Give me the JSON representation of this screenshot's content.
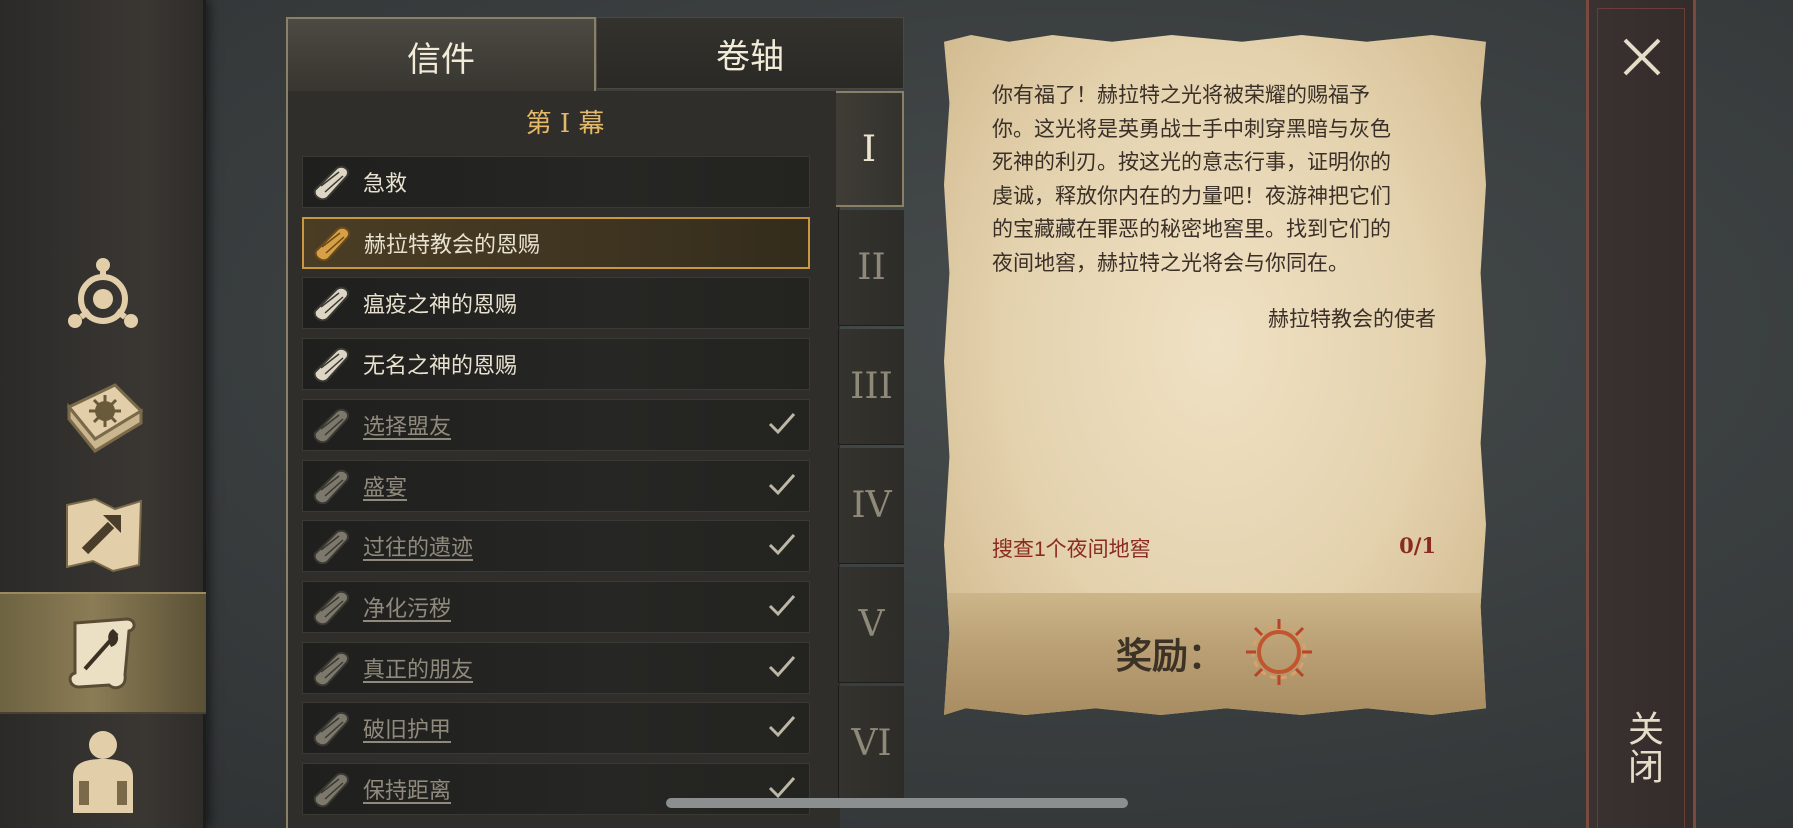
{
  "tabs": {
    "letters": "信件",
    "scrolls": "卷轴"
  },
  "act_title": "第 I 幕",
  "quests": [
    {
      "label": "急救",
      "done": false,
      "selected": false
    },
    {
      "label": "赫拉特教会的恩赐",
      "done": false,
      "selected": true
    },
    {
      "label": "瘟疫之神的恩赐",
      "done": false,
      "selected": false
    },
    {
      "label": "无名之神的恩赐",
      "done": false,
      "selected": false
    },
    {
      "label": "选择盟友",
      "done": true,
      "selected": false
    },
    {
      "label": "盛宴",
      "done": true,
      "selected": false
    },
    {
      "label": "过往的遗迹",
      "done": true,
      "selected": false
    },
    {
      "label": "净化污秽",
      "done": true,
      "selected": false
    },
    {
      "label": "真正的朋友",
      "done": true,
      "selected": false
    },
    {
      "label": "破旧护甲",
      "done": true,
      "selected": false
    },
    {
      "label": "保持距离",
      "done": true,
      "selected": false
    }
  ],
  "acts": [
    "I",
    "II",
    "III",
    "IV",
    "V",
    "VI"
  ],
  "active_act": "I",
  "letter": {
    "lines": [
      "你有福了！赫拉特之光将被荣耀的赐福予",
      "你。这光将是英勇战士手中刺穿黑暗与灰色",
      "死神的利刃。按这光的意志行事，证明你的",
      "虔诚，释放你内在的力量吧！夜游神把它们",
      "的宝藏藏在罪恶的秘密地窖里。找到它们的",
      "夜间地窖，赫拉特之光将会与你同在。"
    ],
    "signature": "赫拉特教会的使者",
    "objective": "搜查1个夜间地窖",
    "progress": "0/1",
    "reward_label": "奖励："
  },
  "close_label": "关闭",
  "icons": {
    "nav": [
      "map-marker-icon",
      "spellbook-icon",
      "map-icon",
      "quest-scroll-icon",
      "character-icon"
    ],
    "quest": "scroll-icon",
    "check": "checkmark-icon",
    "reward": "thorn-ring-icon",
    "close": "close-icon"
  },
  "colors": {
    "accent": "#e5b868",
    "objective": "#8a2a22",
    "selected_border": "#c9983e"
  }
}
